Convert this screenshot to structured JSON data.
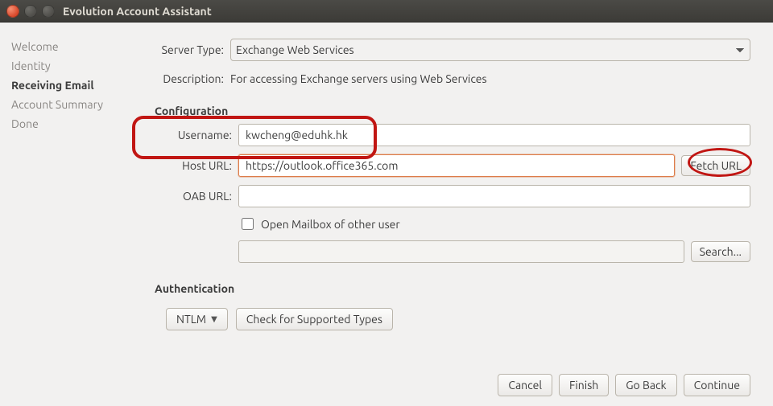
{
  "window": {
    "title": "Evolution Account Assistant"
  },
  "sidebar": {
    "items": [
      {
        "label": "Welcome",
        "active": false
      },
      {
        "label": "Identity",
        "active": false
      },
      {
        "label": "Receiving Email",
        "active": true
      },
      {
        "label": "Account Summary",
        "active": false
      },
      {
        "label": "Done",
        "active": false
      }
    ]
  },
  "server_type": {
    "label": "Server Type:",
    "value": "Exchange Web Services"
  },
  "description": {
    "label": "Description:",
    "text": "For accessing Exchange servers using Web Services"
  },
  "configuration": {
    "title": "Configuration",
    "username_label": "Username:",
    "username_value": "kwcheng@eduhk.hk",
    "host_label": "Host URL:",
    "host_value": "https://outlook.office365.com",
    "fetch_url_label": "Fetch URL",
    "oab_label": "OAB URL:",
    "oab_value": "",
    "open_mailbox_label": "Open Mailbox of other user",
    "open_mailbox_checked": false,
    "mailbox_value": "",
    "search_label": "Search..."
  },
  "authentication": {
    "title": "Authentication",
    "method": "NTLM",
    "check_types_label": "Check for Supported Types"
  },
  "footer": {
    "cancel": "Cancel",
    "finish": "Finish",
    "go_back": "Go Back",
    "continue": "Continue"
  }
}
